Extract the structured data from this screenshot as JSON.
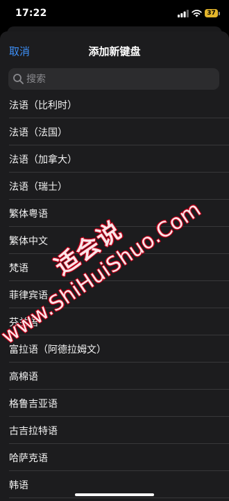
{
  "status_bar": {
    "time": "17:22",
    "battery_level": "37",
    "battery_color": "#e3b52b"
  },
  "nav": {
    "cancel_label": "取消",
    "title": "添加新键盘"
  },
  "search": {
    "placeholder": "搜索"
  },
  "languages": [
    "法语（比利时）",
    "法语（法国）",
    "法语（加拿大）",
    "法语（瑞士）",
    "繁体粤语",
    "繁体中文",
    "梵语",
    "菲律宾语",
    "芬兰语",
    "富拉语（阿德拉姆文）",
    "高棉语",
    "格鲁吉亚语",
    "古吉拉特语",
    "哈萨克语",
    "韩语"
  ],
  "watermark": {
    "cn": "适会说",
    "url": "www.ShiHuiShuo.Com"
  },
  "colors": {
    "accent": "#3d8ff7",
    "sheet_bg": "#1c1c1e",
    "search_bg": "#2c2c2e"
  }
}
